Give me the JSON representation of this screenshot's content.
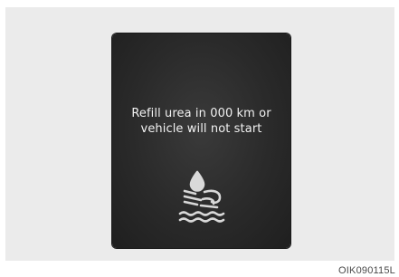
{
  "display": {
    "message_line1": "Refill urea in 000 km or",
    "message_line2": "vehicle will not start",
    "icon": "urea-level-warning-icon"
  },
  "figure": {
    "code": "OIK090115L"
  },
  "colors": {
    "background": "#ebebeb",
    "screen": "#2a2a2a",
    "text": "#f2f2f2"
  }
}
